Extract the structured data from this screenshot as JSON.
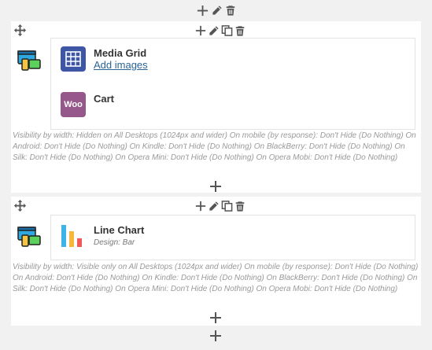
{
  "rows": [
    {
      "widgets": [
        {
          "title": "Media Grid",
          "link": "Add images",
          "icon": "grid-icon",
          "color": "#3d56a6"
        },
        {
          "title": "Cart",
          "badge": "Woo",
          "icon": "woocommerce-icon",
          "color": "#96588a"
        }
      ],
      "visibility": "Visibility by width: Hidden on All Desktops (1024px and wider)  On mobile (by response): Don't Hide (Do Nothing)  On Android: Don't Hide (Do Nothing)  On Kindle: Don't Hide (Do Nothing)  On BlackBerry: Don't Hide (Do Nothing)  On Silk: Don't Hide (Do Nothing)  On Opera Mini: Don't Hide (Do Nothing)  On Opera Mobi: Don't Hide (Do Nothing)"
    },
    {
      "widgets": [
        {
          "title": "Line Chart",
          "subtitle": "Design: Bar",
          "icon": "bar-chart-icon"
        }
      ],
      "visibility": "Visibility by width: Visible only on All Desktops (1024px and wider)  On mobile (by response): Don't Hide (Do Nothing)  On Android: Don't Hide (Do Nothing)  On Kindle: Don't Hide (Do Nothing)  On BlackBerry: Don't Hide (Do Nothing)  On Silk: Don't Hide (Do Nothing)  On Opera Mini: Don't Hide (Do Nothing)  On Opera Mobi: Don't Hide (Do Nothing)"
    }
  ],
  "colors": {
    "icon_gray": "#555555",
    "background": "#f1f1f1",
    "link": "#2a6496"
  }
}
